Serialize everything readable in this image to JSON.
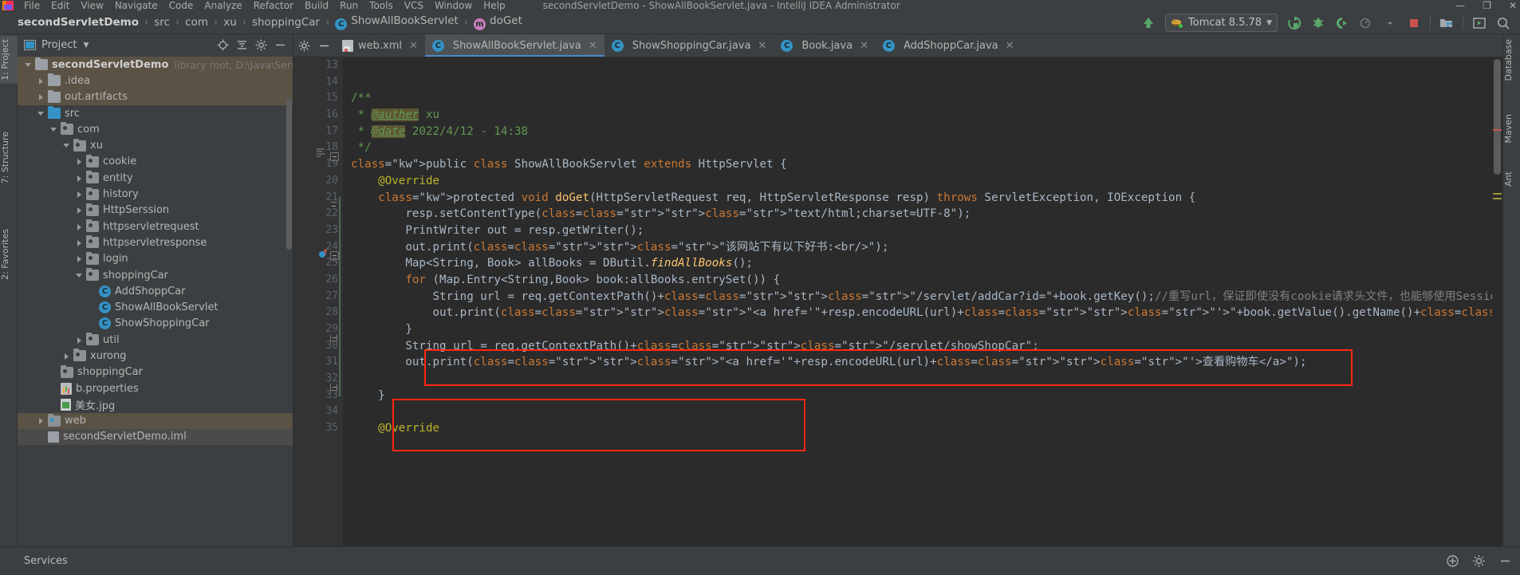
{
  "window": {
    "title": "secondServletDemo - ShowAllBookServlet.java - IntelliJ IDEA  Administrator",
    "minimize": "—",
    "maximize": "❐",
    "close": "✕"
  },
  "menu": {
    "items": [
      "File",
      "Edit",
      "View",
      "Navigate",
      "Code",
      "Analyze",
      "Refactor",
      "Build",
      "Run",
      "Tools",
      "VCS",
      "Window",
      "Help"
    ]
  },
  "breadcrumb": {
    "items": [
      {
        "label": "secondServletDemo",
        "icon": "",
        "bold": true
      },
      {
        "label": "src",
        "icon": "",
        "bold": false
      },
      {
        "label": "com",
        "icon": "",
        "bold": false
      },
      {
        "label": "xu",
        "icon": "",
        "bold": false
      },
      {
        "label": "shoppingCar",
        "icon": "",
        "bold": false
      },
      {
        "label": "ShowAllBookServlet",
        "icon": "class-icon",
        "bold": false
      },
      {
        "label": "doGet",
        "icon": "method-icon",
        "bold": false
      }
    ],
    "separator": "›"
  },
  "toolbar": {
    "run_config": "Tomcat 8.5.78",
    "dropdown_caret": "▼",
    "icons": [
      "build-icon",
      "run-icon",
      "debug-icon",
      "run-coverage-icon",
      "profiler-icon",
      "stop-icon",
      "project-structure-icon",
      "run-anything-icon",
      "search-icon"
    ],
    "accent_green": "#59a869",
    "accent_red": "#c75450"
  },
  "left_tool_strip": {
    "tabs": [
      {
        "label": "1: Project",
        "selected": true
      },
      {
        "label": "7: Structure",
        "selected": false
      },
      {
        "label": "2: Favorites",
        "selected": false
      }
    ]
  },
  "right_tool_strip": {
    "tabs": [
      {
        "label": "Database"
      },
      {
        "label": "Maven"
      },
      {
        "label": "Ant"
      }
    ]
  },
  "project_panel": {
    "title": "Project",
    "title_caret": "▼",
    "header_icons": [
      "locate-icon",
      "collapse-all-icon",
      "settings-icon",
      "hide-icon"
    ],
    "tree": [
      {
        "indent": 0,
        "arrow": "open",
        "icon": "module-folder",
        "label": "secondServletDemo",
        "bold": true,
        "dim": "library root,  D:\\Java\\Servlet\\",
        "highlight": true
      },
      {
        "indent": 1,
        "arrow": "closed",
        "icon": "folder-gray",
        "label": ".idea",
        "highlight": true
      },
      {
        "indent": 1,
        "arrow": "closed",
        "icon": "folder-gray",
        "label": "out.artifacts",
        "highlight": true
      },
      {
        "indent": 1,
        "arrow": "open",
        "icon": "folder-blue",
        "label": "src"
      },
      {
        "indent": 2,
        "arrow": "open",
        "icon": "package",
        "label": "com"
      },
      {
        "indent": 3,
        "arrow": "open",
        "icon": "package",
        "label": "xu"
      },
      {
        "indent": 4,
        "arrow": "closed",
        "icon": "package",
        "label": "cookie"
      },
      {
        "indent": 4,
        "arrow": "closed",
        "icon": "package",
        "label": "entity"
      },
      {
        "indent": 4,
        "arrow": "closed",
        "icon": "package",
        "label": "history"
      },
      {
        "indent": 4,
        "arrow": "closed",
        "icon": "package",
        "label": "HttpSerssion"
      },
      {
        "indent": 4,
        "arrow": "closed",
        "icon": "package",
        "label": "httpservletrequest"
      },
      {
        "indent": 4,
        "arrow": "closed",
        "icon": "package",
        "label": "httpservletresponse"
      },
      {
        "indent": 4,
        "arrow": "closed",
        "icon": "package",
        "label": "login"
      },
      {
        "indent": 4,
        "arrow": "open",
        "icon": "package",
        "label": "shoppingCar"
      },
      {
        "indent": 5,
        "arrow": "none",
        "icon": "class",
        "label": "AddShoppCar"
      },
      {
        "indent": 5,
        "arrow": "none",
        "icon": "class",
        "label": "ShowAllBookServlet"
      },
      {
        "indent": 5,
        "arrow": "none",
        "icon": "class",
        "label": "ShowShoppingCar"
      },
      {
        "indent": 4,
        "arrow": "closed",
        "icon": "package",
        "label": "util"
      },
      {
        "indent": 3,
        "arrow": "closed",
        "icon": "package",
        "label": "xurong"
      },
      {
        "indent": 2,
        "arrow": "none",
        "icon": "package",
        "label": "shoppingCar"
      },
      {
        "indent": 2,
        "arrow": "none",
        "icon": "properties",
        "label": "b.properties"
      },
      {
        "indent": 2,
        "arrow": "none",
        "icon": "image",
        "label": "美女.jpg"
      },
      {
        "indent": 1,
        "arrow": "closed",
        "icon": "package-blue",
        "label": "web",
        "highlight": true
      },
      {
        "indent": 1,
        "arrow": "none",
        "icon": "iml",
        "label": "secondServletDemo.iml",
        "selected": true
      }
    ]
  },
  "editor_tabs": [
    {
      "label": "web.xml",
      "icon": "xml-icon",
      "active": false,
      "close": "✕"
    },
    {
      "label": "ShowAllBookServlet.java",
      "icon": "class-icon",
      "active": true,
      "close": "✕"
    },
    {
      "label": "ShowShoppingCar.java",
      "icon": "class-icon",
      "active": false,
      "close": "✕"
    },
    {
      "label": "Book.java",
      "icon": "class-icon",
      "active": false,
      "close": "✕"
    },
    {
      "label": "AddShoppCar.java",
      "icon": "class-icon",
      "active": false,
      "close": "✕"
    }
  ],
  "editor": {
    "file": "ShowAllBookServlet.java",
    "first_line": 13,
    "lines": [
      {
        "n": 13,
        "text": ""
      },
      {
        "n": 14,
        "text": ""
      },
      {
        "n": 15,
        "text": "/**"
      },
      {
        "n": 16,
        "text": " * @auther xu"
      },
      {
        "n": 17,
        "text": " * @date 2022/4/12 - 14:38"
      },
      {
        "n": 18,
        "text": " */"
      },
      {
        "n": 19,
        "text": "public class ShowAllBookServlet extends HttpServlet {"
      },
      {
        "n": 20,
        "text": "    @Override"
      },
      {
        "n": 21,
        "text": "    protected void doGet(HttpServletRequest req, HttpServletResponse resp) throws ServletException, IOException {"
      },
      {
        "n": 22,
        "text": "        resp.setContentType(\"text/html;charset=UTF-8\");"
      },
      {
        "n": 23,
        "text": "        PrintWriter out = resp.getWriter();"
      },
      {
        "n": 24,
        "text": "        out.print(\"该网站下有以下好书:<br/>\");"
      },
      {
        "n": 25,
        "text": "        Map<String, Book> allBooks = DButil.findAllBooks();"
      },
      {
        "n": 26,
        "text": "        for (Map.Entry<String,Book> book:allBooks.entrySet()) {"
      },
      {
        "n": 27,
        "text": "            String url = req.getContextPath()+\"/servlet/addCar?id=\"+book.getKey();//重写url，保证即使没有cookie请求头文件，也能够使用Session域"
      },
      {
        "n": 28,
        "text": "            out.print(\"<a href='\"+resp.encodeURL(url)+\"'>\"+book.getValue().getName()+\"</a><br/>\");"
      },
      {
        "n": 29,
        "text": "        }"
      },
      {
        "n": 30,
        "text": "        String url = req.getContextPath()+\"/servlet/showShopCar\";"
      },
      {
        "n": 31,
        "text": "        out.print(\"<a href='\"+resp.encodeURL(url)+\"'>查看购物车</a>\");"
      },
      {
        "n": 32,
        "text": ""
      },
      {
        "n": 33,
        "text": "    }"
      },
      {
        "n": 34,
        "text": ""
      },
      {
        "n": 35,
        "text": "    @Override"
      }
    ],
    "annotations": [
      {
        "name": "red-highlight-box-1",
        "covers_lines": "27-28",
        "color": "#fe2712"
      },
      {
        "name": "red-highlight-box-2",
        "covers_lines": "30-31",
        "color": "#fe2712"
      }
    ]
  },
  "statusbar": {
    "services_label": "Services",
    "right_icons": [
      "event-log-icon",
      "settings-icon",
      "hide-icon"
    ]
  }
}
